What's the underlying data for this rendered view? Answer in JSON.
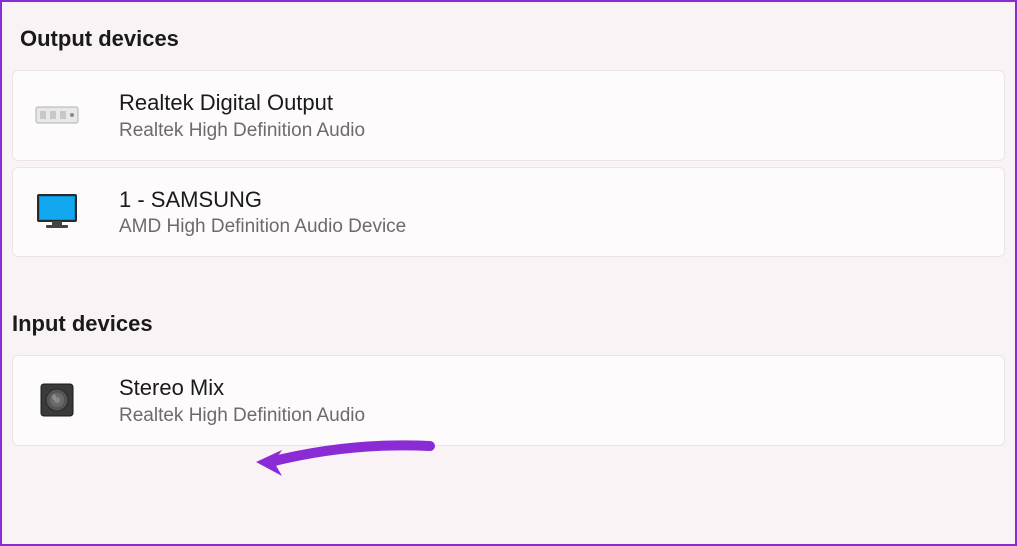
{
  "sections": {
    "output": {
      "header": "Output devices",
      "devices": [
        {
          "title": "Realtek Digital Output",
          "subtitle": "Realtek High Definition Audio",
          "icon": "audio-device-icon"
        },
        {
          "title": "1 - SAMSUNG",
          "subtitle": "AMD High Definition Audio Device",
          "icon": "monitor-icon"
        }
      ]
    },
    "input": {
      "header": "Input devices",
      "devices": [
        {
          "title": "Stereo Mix",
          "subtitle": "Realtek High Definition Audio",
          "icon": "speaker-icon"
        }
      ]
    }
  },
  "colors": {
    "accent": "#8b2bd6",
    "background": "#faf3f6",
    "cardBackground": "#fefbfc",
    "textPrimary": "#1a1a1a",
    "textSecondary": "#6b6b6b"
  }
}
